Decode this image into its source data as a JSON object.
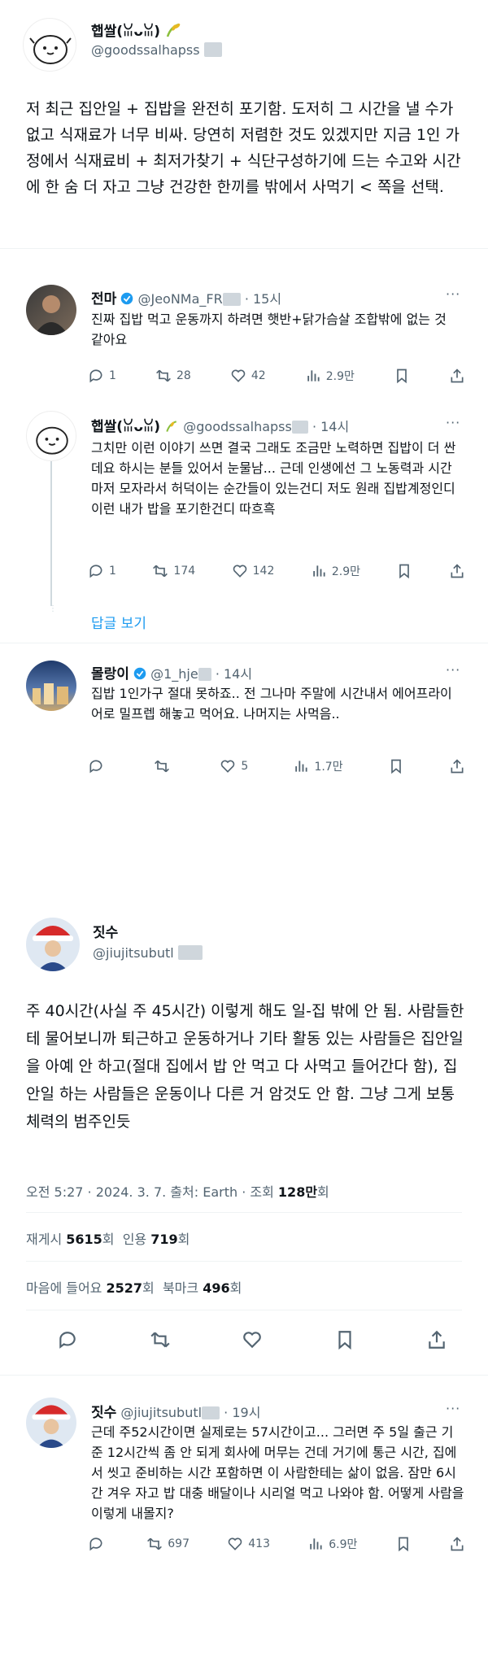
{
  "post1": {
    "author_name": "햅쌀(ꈍᴗꈍ)",
    "author_handle": "@goodssalhapss",
    "text": "저 최근 집안일 + 집밥을 완전히 포기함. 도저히 그 시간을 낼 수가 없고 식재료가 너무 비싸. 당연히 저렴한 것도 있겠지만 지금 1인 가정에서 식재료비 + 최저가찾기 + 식단구성하기에 드는 수고와 시간에 한 숨 더 자고 그냥 건강한 한끼를 밖에서 사먹기 < 쪽을 선택."
  },
  "reply1": {
    "author_name": "전마",
    "author_handle": "@JeoNMa_FR",
    "time": "· 15시",
    "text": "진짜 집밥 먹고 운동까지 하려면 햇반+닭가슴살 조합밖에 없는 것 같아요",
    "replies": "1",
    "retweets": "28",
    "likes": "42",
    "views": "2.9만"
  },
  "reply2": {
    "author_name": "햅쌀(ꈍᴗꈍ)",
    "author_handle": "@goodssalhapss",
    "time": "· 14시",
    "text": "그치만 이런 이야기 쓰면 결국 그래도 조금만 노력하면 집밥이 더 싼데요 하시는 분들 있어서 눈물남... 근데 인생에선 그 노동력과 시간마저 모자라서 허덕이는 순간들이 있는건디 저도 원래 집밥계정인디 이런 내가 밥을 포기한건디 따흐흑",
    "replies": "1",
    "retweets": "174",
    "likes": "142",
    "views": "2.9만"
  },
  "show_replies": "답글 보기",
  "reply3": {
    "author_name": "몰랑이",
    "author_handle": "@1_hje",
    "time": "· 14시",
    "text": "집밥 1인가구 절대 못하죠.. 전 그나마 주말에 시간내서 에어프라이어로 밀프렙 해놓고 먹어요. 나머지는 사먹음..",
    "replies": "",
    "retweets": "",
    "likes": "5",
    "views": "1.7만"
  },
  "post2": {
    "author_name": "짓수",
    "author_handle": "@jiujitsubutl",
    "text": "주 40시간(사실 주 45시간) 이렇게 해도 일-집 밖에 안 됨. 사람들한테 물어보니까 퇴근하고 운동하거나 기타 활동 있는 사람들은 집안일을 아예 안 하고(절대 집에서 밥 안 먹고 다 사먹고 들어간다 함), 집안일 하는 사람들은 운동이나 다른 거 암것도 안 함. 그냥 그게 보통체력의 범주인듯",
    "meta": "오전 5:27 · 2024. 3. 7. 출처: Earth · 조회 ",
    "views_count": "128만",
    "views_suffix": "회",
    "reposts_label": "재게시 ",
    "reposts_count": "5615",
    "reposts_suffix": "회",
    "quotes_label": "인용 ",
    "quotes_count": "719",
    "quotes_suffix": "회",
    "likes_label": "마음에 들어요 ",
    "likes_count": "2527",
    "likes_suffix": "회",
    "bookmarks_label": "북마크 ",
    "bookmarks_count": "496",
    "bookmarks_suffix": "회"
  },
  "reply4": {
    "author_name": "짓수",
    "author_handle": "@jiujitsubutl",
    "time": "· 19시",
    "text": "근데 주52시간이면 실제로는 57시간이고... 그러면 주 5일 출근 기준 12시간씩 좀 안 되게 회사에 머무는 건데 거기에 통근 시간, 집에서 씻고 준비하는 시간 포함하면 이 사람한테는 삶이 없음. 잠만 6시간 겨우 자고 밥 대충 배달이나 시리얼 먹고 나와야 함. 어떻게 사람을 이렇게 내몰지?",
    "replies": "",
    "retweets": "697",
    "likes": "413",
    "views": "6.9만"
  },
  "colors": {
    "accent": "#1d9bf0",
    "muted": "#536471",
    "text": "#0f1419"
  }
}
